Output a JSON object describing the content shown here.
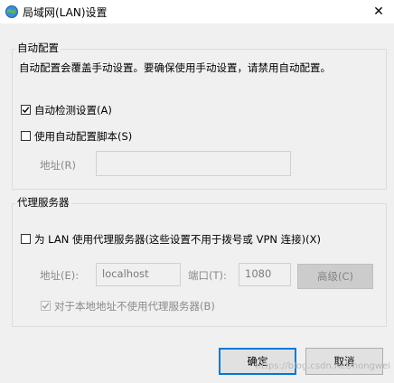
{
  "window": {
    "title": "局域网(LAN)设置",
    "close_glyph": "✕",
    "icon": "network-globe-icon"
  },
  "auto_config": {
    "group_title": "自动配置",
    "description": "自动配置会覆盖手动设置。要确保使用手动设置，请禁用自动配置。",
    "auto_detect_label": "自动检测设置(A)",
    "auto_detect_checked": true,
    "use_script_label": "使用自动配置脚本(S)",
    "use_script_checked": false,
    "address_label": "地址(R)",
    "address_value": ""
  },
  "proxy": {
    "group_title": "代理服务器",
    "use_proxy_label": "为 LAN 使用代理服务器(这些设置不用于拨号或 VPN 连接)(X)",
    "use_proxy_checked": false,
    "address_label": "地址(E):",
    "address_value": "localhost",
    "port_label": "端口(T):",
    "port_value": "1080",
    "advanced_label": "高级(C)",
    "bypass_local_label": "对于本地地址不使用代理服务器(B)",
    "bypass_local_checked": true
  },
  "buttons": {
    "ok_label": "确定",
    "cancel_label": "取消"
  },
  "watermark": "https://blog.csdn.net/hongwei"
}
